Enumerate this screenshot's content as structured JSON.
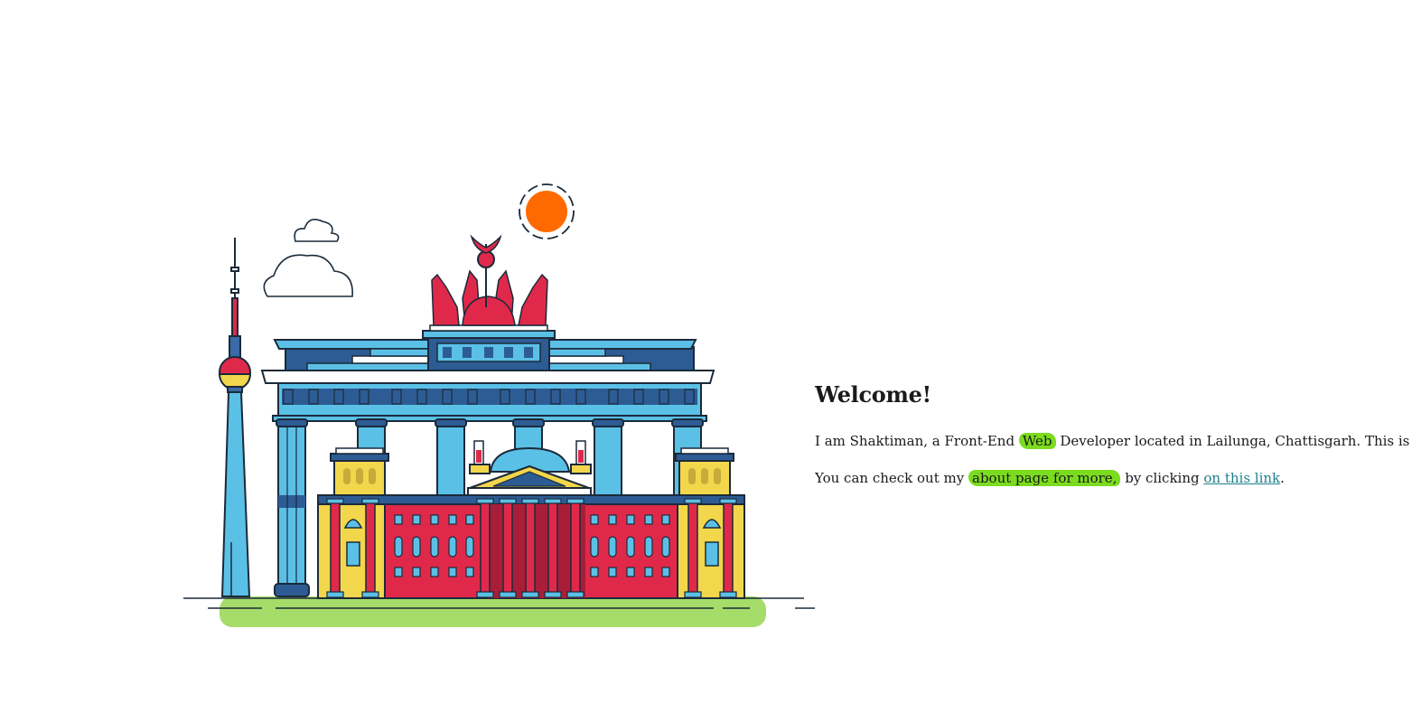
{
  "welcome": {
    "title": "Welcome!",
    "intro": {
      "before": "I am Shaktiman, a Front-End",
      "highlight": "Web",
      "after": "Developer located in Lailunga, Chattisgarh. This is my"
    },
    "about": {
      "before": "You can check out my",
      "highlight": "about page for more,",
      "middle": "by clicking",
      "link": "on this link",
      "end": "."
    }
  },
  "colors": {
    "highlight": "#7bdc1f",
    "link": "#1e7f8c",
    "sun": "#ff6a00",
    "ground": "#a6dc6a"
  },
  "illustration": {
    "icon": "berlin-landmarks-illustration"
  }
}
